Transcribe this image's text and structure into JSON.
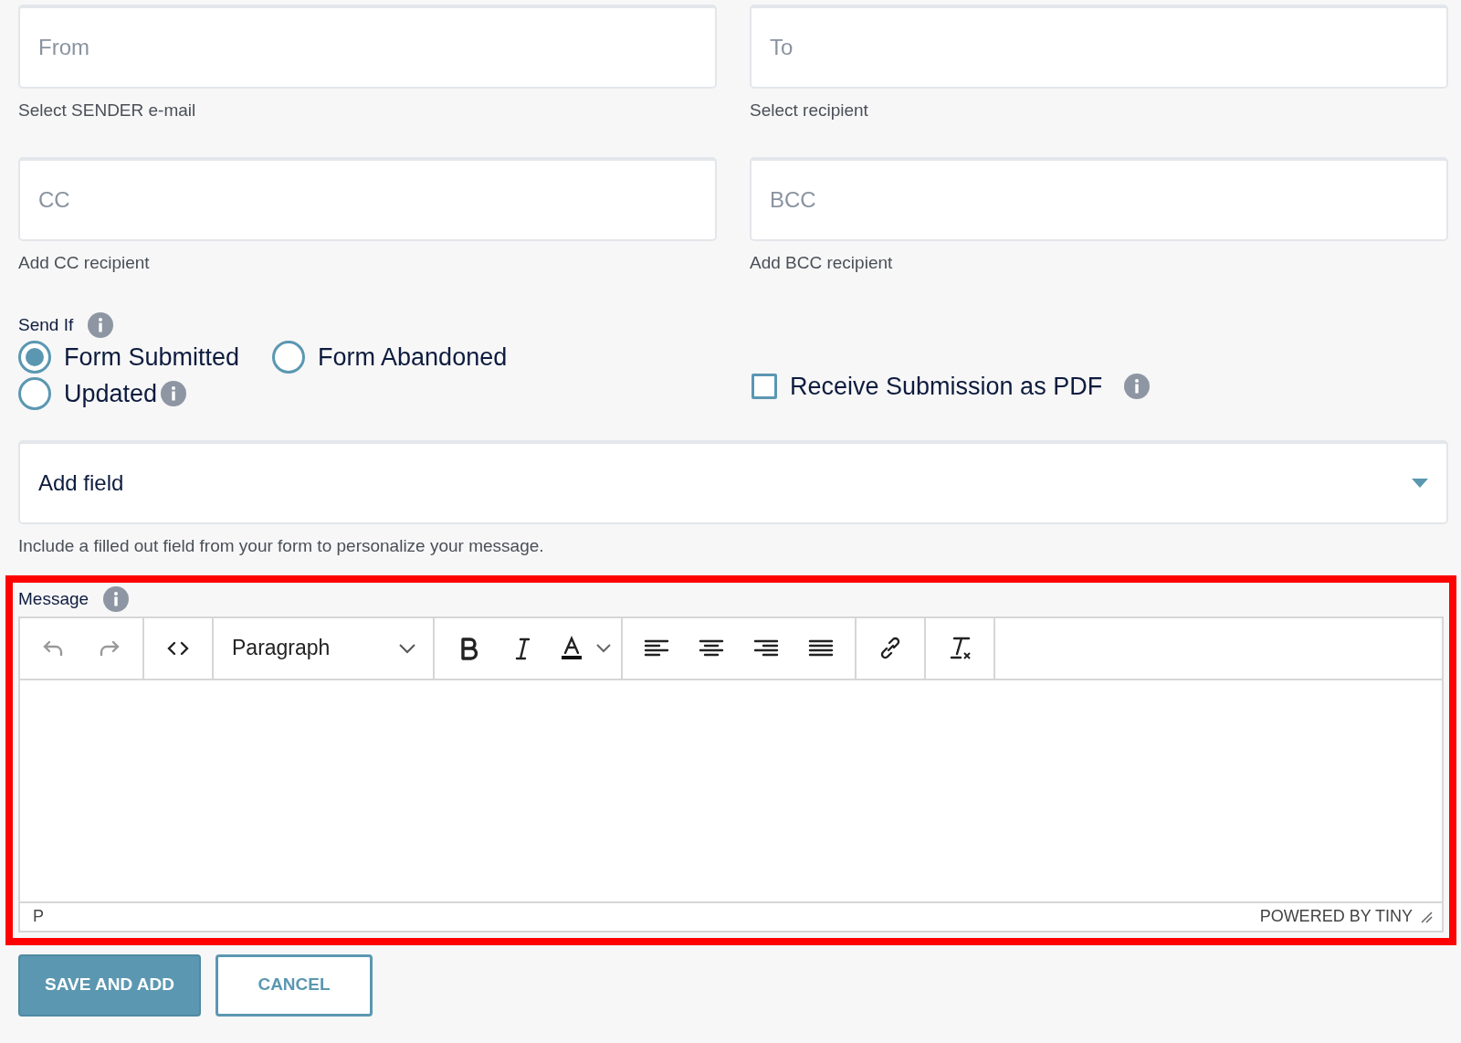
{
  "fields": [
    {
      "placeholder": "From",
      "help": "Select SENDER e-mail"
    },
    {
      "placeholder": "To",
      "help": "Select recipient"
    },
    {
      "placeholder": "CC",
      "help": "Add CC recipient"
    },
    {
      "placeholder": "BCC",
      "help": "Add BCC recipient"
    }
  ],
  "send_if": {
    "label": "Send If",
    "options": [
      {
        "label": "Form Submitted",
        "selected": true,
        "info": false
      },
      {
        "label": "Form Abandoned",
        "selected": false,
        "info": false
      },
      {
        "label": "Updated",
        "selected": false,
        "info": true
      }
    ]
  },
  "pdf_option": {
    "label": "Receive Submission as PDF",
    "checked": false
  },
  "add_field": {
    "value": "Add field",
    "help": "Include a filled out field from your form to personalize your message."
  },
  "message": {
    "label": "Message",
    "highlighted": true,
    "toolbar": [
      [
        {
          "kind": "undo",
          "disabled": true
        },
        {
          "kind": "redo",
          "disabled": true
        }
      ],
      [
        {
          "kind": "code"
        }
      ],
      [
        {
          "kind": "select",
          "label": "Paragraph"
        }
      ],
      [
        {
          "kind": "bold"
        },
        {
          "kind": "italic"
        },
        {
          "kind": "color"
        }
      ],
      [
        {
          "kind": "align-left"
        },
        {
          "kind": "align-center"
        },
        {
          "kind": "align-right"
        },
        {
          "kind": "justify"
        }
      ],
      [
        {
          "kind": "link"
        }
      ],
      [
        {
          "kind": "clear"
        }
      ]
    ],
    "path": "P",
    "branding": "POWERED BY TINY"
  },
  "buttons": [
    {
      "label": "SAVE AND ADD",
      "primary": true
    },
    {
      "label": "CANCEL",
      "primary": false
    }
  ]
}
